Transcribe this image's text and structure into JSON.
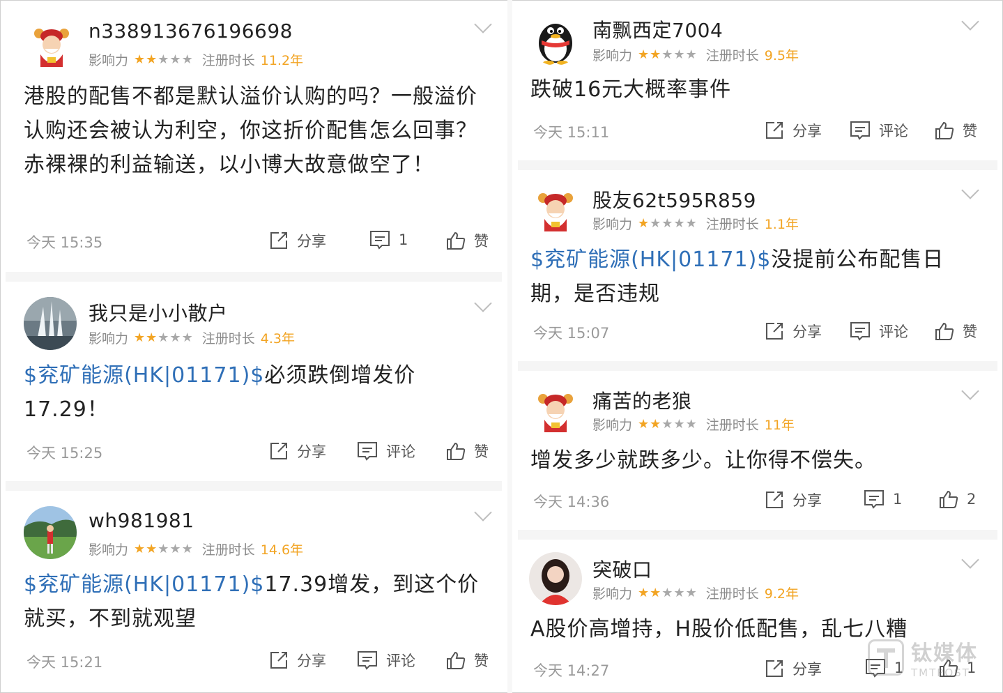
{
  "labels": {
    "influence": "影响力",
    "reg_duration": "注册时长",
    "share": "分享",
    "comment": "评论",
    "like": "赞"
  },
  "posts": [
    {
      "username": "n338913676196698",
      "influence_stars": 2,
      "years": "11.2年",
      "text": "港股的配售不都是默认溢价认购的吗？一般溢价认购还会被认为利空，你这折价配售怎么回事？赤裸裸的利益输送，以小博大故意做空了！",
      "time": "今天 15:35",
      "comment_label": "1",
      "like_label": "赞",
      "avatar": "caishen-avatar"
    },
    {
      "username": "我只是小小散户",
      "influence_stars": 2,
      "years": "4.3年",
      "stock_tag": "$兖矿能源(HK|01171)$",
      "text": "必须跌倒增发价17.29！",
      "time": "今天 15:25",
      "comment_label": "评论",
      "like_label": "赞",
      "avatar": "fountain-photo-avatar"
    },
    {
      "username": "wh981981",
      "influence_stars": 2,
      "years": "14.6年",
      "stock_tag": "$兖矿能源(HK|01171)$",
      "text": "17.39增发，到这个价就买，不到就观望",
      "time": "今天 15:21",
      "comment_label": "评论",
      "like_label": "赞",
      "avatar": "golf-photo-avatar"
    },
    {
      "username": "南飘西定7004",
      "influence_stars": 2,
      "years": "9.5年",
      "text": "跌破16元大概率事件",
      "time": "今天 15:11",
      "comment_label": "评论",
      "like_label": "赞",
      "avatar": "qq-penguin-avatar"
    },
    {
      "username": "股友62t595R859",
      "influence_stars": 1,
      "years": "1.1年",
      "stock_tag": "$兖矿能源(HK|01171)$",
      "text": "没提前公布配售日期，是否违规",
      "time": "今天 15:07",
      "comment_label": "评论",
      "like_label": "赞",
      "avatar": "caishen-avatar"
    },
    {
      "username": "痛苦的老狼",
      "influence_stars": 2,
      "years": "11年",
      "text": "增发多少就跌多少。让你得不偿失。",
      "time": "今天 14:36",
      "comment_label": "1",
      "like_label": "2",
      "avatar": "caishen-avatar"
    },
    {
      "username": "突破口",
      "influence_stars": 2,
      "years": "9.2年",
      "text": "A股价高增持，H股价低配售，乱七八糟",
      "time": "今天 14:27",
      "comment_label": "1",
      "like_label": "1",
      "avatar": "woman-photo-avatar"
    }
  ],
  "watermark": {
    "cn": "钛媒体",
    "en": "TMTPOST"
  },
  "colors": {
    "stock_link": "#2f6fb7",
    "star_on": "#f2a423",
    "years": "#f2a423"
  }
}
